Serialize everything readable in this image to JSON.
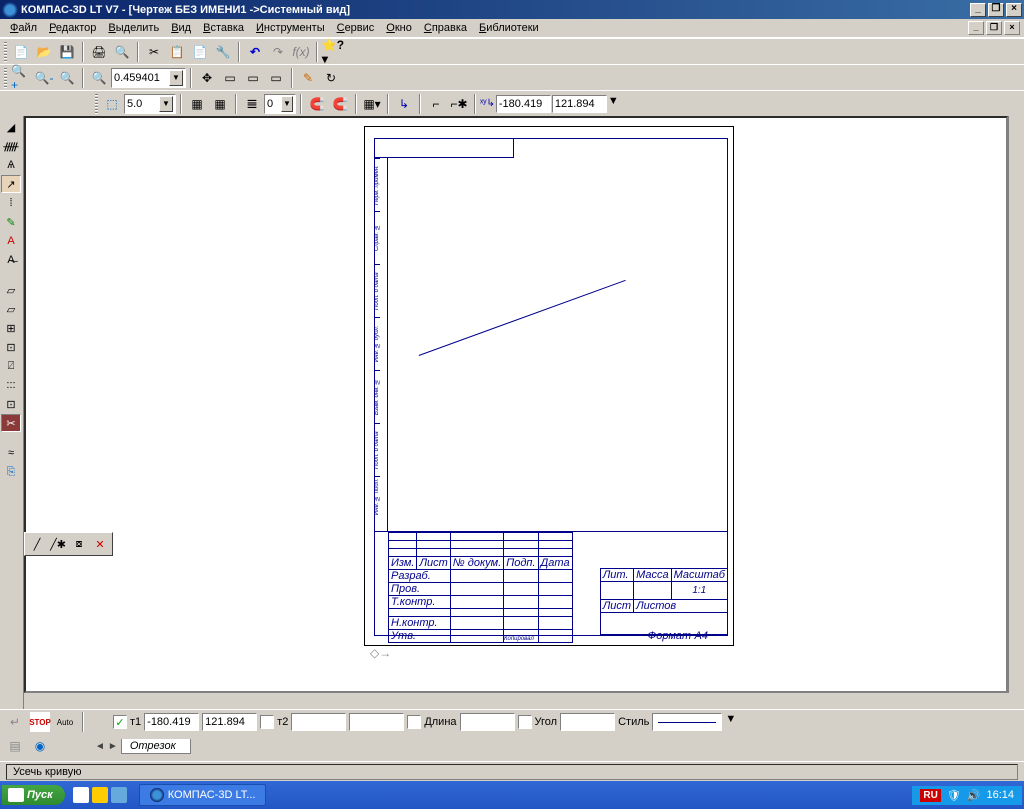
{
  "titlebar": {
    "app": "КОМПАС-3D LT V7 - ",
    "doc": "[Чертеж БЕЗ ИМЕНИ1 ->Системный вид]"
  },
  "menu": {
    "file": "айл",
    "file_u": "Ф",
    "edit": "едактор",
    "edit_u": "Р",
    "select": "ыделить",
    "select_u": "В",
    "view": "ид",
    "view_u": "В",
    "insert": "ставка",
    "insert_u": "В",
    "tools": "нструменты",
    "tools_u": "И",
    "service": "ервис",
    "service_u": "С",
    "window": "кно",
    "window_u": "О",
    "help": "правка",
    "help_u": "С",
    "library": "иблиотеки",
    "library_u": "Б"
  },
  "toolbar2": {
    "zoom": "0.459401"
  },
  "toolbar3": {
    "thickness": "5.0",
    "coord_x": "-180.419",
    "coord_y": "121.894"
  },
  "proppanel": {
    "t1_label": "т1",
    "t1_x": "-180.419",
    "t1_y": "121.894",
    "t2_label": "т2",
    "t2_x": "",
    "t2_y": "",
    "length_label": "Длина",
    "length": "",
    "angle_label": "Угол",
    "angle": "",
    "style_label": "Стиль",
    "tab": "Отрезок"
  },
  "status": {
    "hint": "Усечь кривую"
  },
  "taskbar": {
    "start": "Пуск",
    "app": "КОМПАС-3D LT...",
    "lang": "RU",
    "time": "16:14"
  },
  "stamp": {
    "izm": "Изм.",
    "list": "Лист",
    "ndokum": "№ докум.",
    "podp": "Подп.",
    "data": "Дата",
    "razrab": "Разраб.",
    "prov": "Пров.",
    "tkontr": "Т.контр.",
    "nkontr": "Н.контр.",
    "utv": "Утв.",
    "lit": "Лит.",
    "massa": "Масса",
    "masshtab": "Масштаб",
    "scale": "1:1",
    "list2": "Лист",
    "listov": "Листов",
    "kopirov": "Копировал",
    "format": "Формат",
    "a4": "A4"
  },
  "sidestrip": {
    "s1": "Перв. примен.",
    "s2": "Справ. №",
    "s3": "Подп. и дата",
    "s4": "Инв. № дубл.",
    "s5": "Взам. инв. №",
    "s6": "Подп. и дата",
    "s7": "Инв. № подл."
  }
}
